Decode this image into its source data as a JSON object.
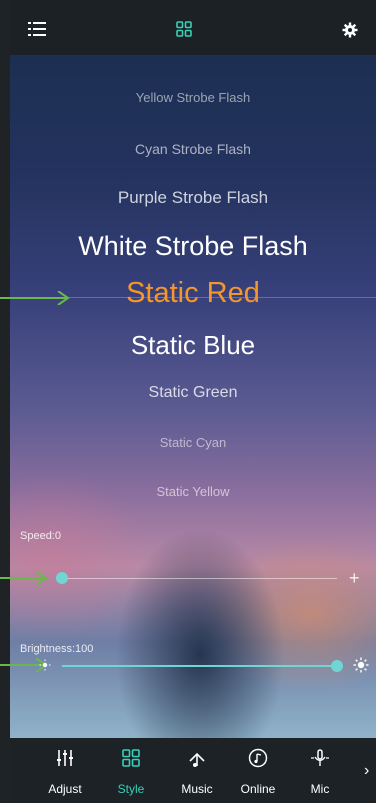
{
  "header": {
    "menu_icon": "menu-icon",
    "center_icon": "grid-icon",
    "settings_icon": "gear-icon"
  },
  "modes": {
    "items": [
      "Yellow Strobe Flash",
      "Cyan Strobe Flash",
      "Purple Strobe Flash",
      "White Strobe Flash",
      "Static Red",
      "Static Blue",
      "Static Green",
      "Static Cyan",
      "Static Yellow"
    ],
    "selected": "Static Red"
  },
  "speed": {
    "label": "Speed:0",
    "value": 0,
    "max": 100
  },
  "brightness": {
    "label": "Brightness:100",
    "value": 100,
    "max": 100
  },
  "tabs": [
    {
      "label": "Adjust",
      "icon": "equalizer-icon",
      "active": false
    },
    {
      "label": "Style",
      "icon": "grid-icon",
      "active": true
    },
    {
      "label": "Music",
      "icon": "music-note-icon",
      "active": false
    },
    {
      "label": "Online",
      "icon": "online-music-icon",
      "active": false
    },
    {
      "label": "Mic",
      "icon": "microphone-icon",
      "active": false
    }
  ],
  "more_tabs_icon": "chevron-right-icon",
  "colors": {
    "accent": "#39d0b8",
    "selected_mode": "#f5962a",
    "slider": "#6fd6d4",
    "annotation_arrow": "#6bb84a"
  }
}
